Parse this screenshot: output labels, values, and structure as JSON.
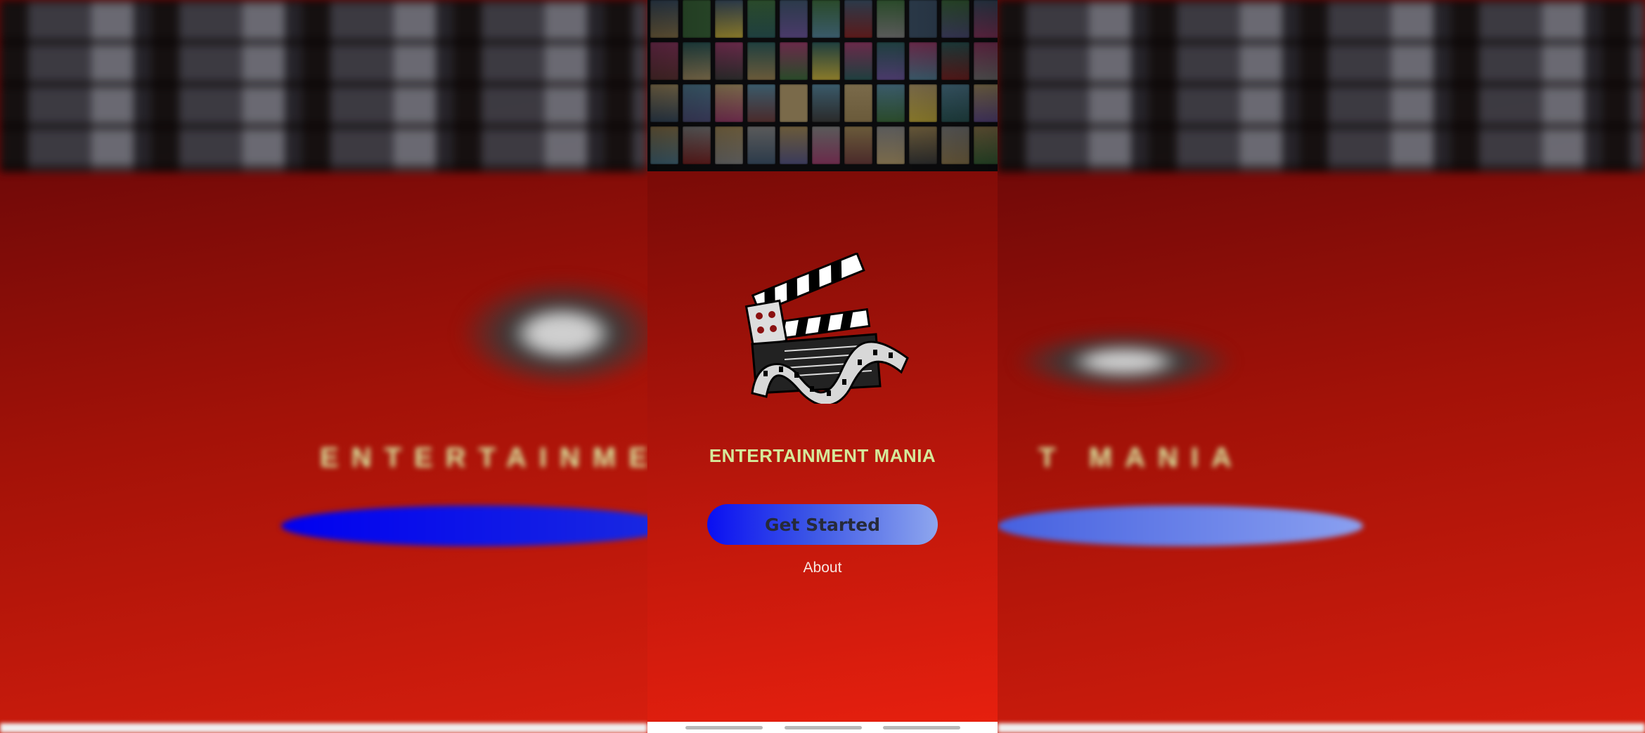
{
  "app": {
    "title": "ENTERTAINMENT MANIA",
    "primary_button": "Get Started",
    "secondary_link": "About"
  },
  "background": {
    "blurred_title": "ENTERTAINMENT MANIA",
    "gradient_top": "#5a0505",
    "gradient_bottom": "#e8200e"
  },
  "colors": {
    "title": "#d5e99a",
    "button_start": "#0a0ff2",
    "button_end": "#8ea6ee",
    "button_text": "#262a3a",
    "link_text": "#f7e6e0"
  },
  "icons": {
    "logo": "clapperboard-with-film-reel-icon"
  },
  "navigation": {
    "gesture_pills": 3
  }
}
